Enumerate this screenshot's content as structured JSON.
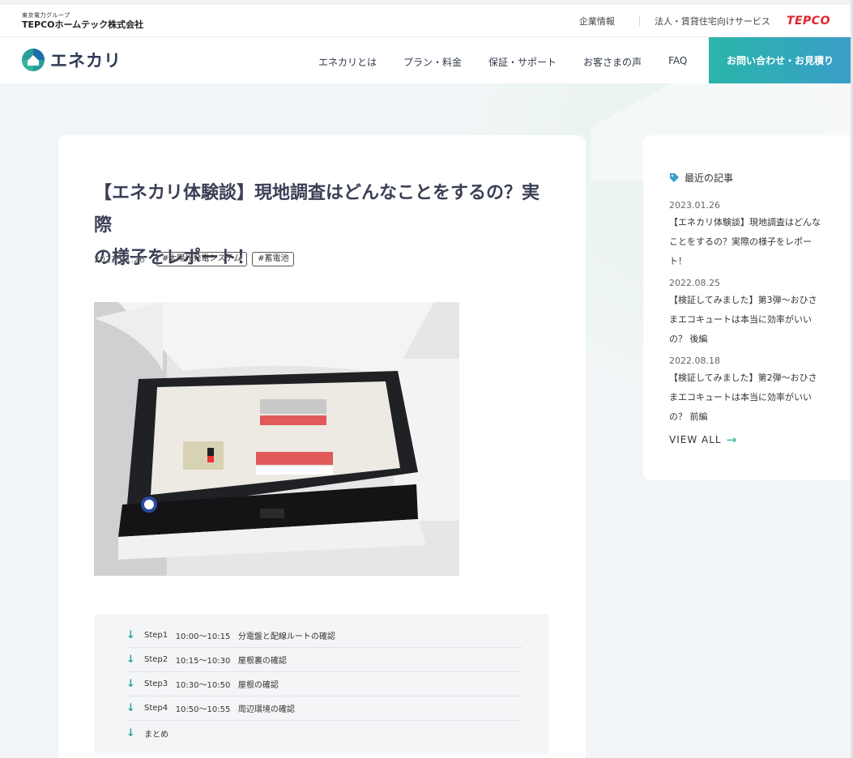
{
  "header": {
    "corp_small": "東京電力グループ",
    "corp_name": "TEPCOホームテック株式会社",
    "link_company": "企業情報",
    "link_business": "法人・賃貸住宅向けサービス",
    "tepco_logo": "TEPCO"
  },
  "nav": {
    "logo_text": "エネカリ",
    "items": [
      {
        "label": "エネカリとは"
      },
      {
        "label": "プラン・料金"
      },
      {
        "label": "保証・サポート"
      },
      {
        "label": "お客さまの声"
      },
      {
        "label": "FAQ"
      }
    ],
    "cta_label": "お問い合わせ・お見積り"
  },
  "article": {
    "title_line1": "【エネカリ体験談】現地調査はどんなことをするの？実際",
    "title_line2": "の様子をレポート！",
    "date": "2023.01.26",
    "tags": [
      "#太陽光発電システム",
      "#蓄電池"
    ],
    "photo_icon": "distribution-board-photo",
    "toc": [
      {
        "step": "Step1",
        "time": "10:00〜10:15",
        "text": "分電盤と配線ルートの確認"
      },
      {
        "step": "Step2",
        "time": "10:15〜10:30",
        "text": "屋根裏の確認"
      },
      {
        "step": "Step3",
        "time": "10:30〜10:50",
        "text": "屋根の確認"
      },
      {
        "step": "Step4",
        "time": "10:50〜10:55",
        "text": "周辺環境の確認"
      },
      {
        "step": "",
        "time": "",
        "text": "まとめ"
      }
    ]
  },
  "sidebar": {
    "heading": "最近の記事",
    "posts": [
      {
        "date": "2023.01.26",
        "lines": [
          "【エネカリ体験談】現地調査はどんな",
          "ことをするの？実際の様子をレポー",
          "ト！"
        ]
      },
      {
        "date": "2022.08.25",
        "lines": [
          "【検証してみました】第3弾〜おひさ",
          "まエコキュートは本当に効率がいい",
          "の？ 後編"
        ]
      },
      {
        "date": "2022.08.18",
        "lines": [
          "【検証してみました】第2弾〜おひさ",
          "まエコキュートは本当に効率がいい",
          "の？ 前編"
        ]
      }
    ],
    "view_all": "VIEW ALL",
    "accent": "#27a89c"
  }
}
